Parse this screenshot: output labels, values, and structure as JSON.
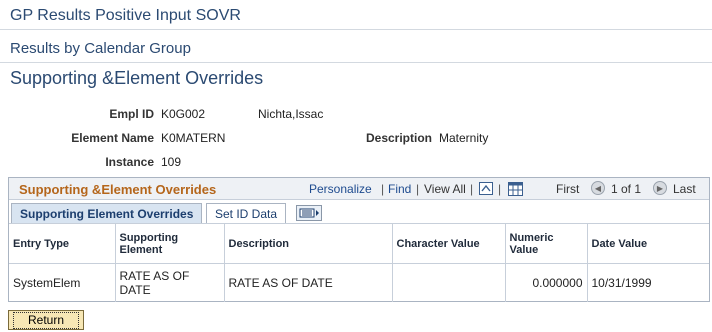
{
  "app_title": "GP Results Positive Input SOVR",
  "breadcrumb": "Results by Calendar Group",
  "page_heading": "Supporting &Element Overrides",
  "fields": {
    "empl_id_label": "Empl ID",
    "empl_id_value": "K0G002",
    "name_value": "Nichta,Issac",
    "element_name_label": "Element Name",
    "element_name_value": "K0MATERN",
    "description_label": "Description",
    "description_value": "Maternity",
    "instance_label": "Instance",
    "instance_value": "109"
  },
  "grid": {
    "title": "Supporting &Element Overrides",
    "personalize": "Personalize",
    "find": "Find",
    "sep": "|",
    "view_all": "View All",
    "first": "First",
    "range": "1 of 1",
    "last": "Last",
    "tabs": {
      "active": "Supporting Element Overrides",
      "inactive": "Set ID Data"
    },
    "columns": {
      "entry_type": "Entry Type",
      "supporting_element": "Supporting Element",
      "description": "Description",
      "character_value": "Character Value",
      "numeric_value": "Numeric Value",
      "date_value": "Date Value"
    },
    "rows": [
      {
        "entry_type": "SystemElem",
        "supporting_element": "RATE AS OF DATE",
        "description": "RATE AS OF DATE",
        "character_value": "",
        "numeric_value": "0.000000",
        "date_value": "10/31/1999"
      }
    ]
  },
  "return_label": "Return",
  "colors": {
    "heading_blue": "#2b4a72",
    "grid_title_orange": "#b5661b",
    "link_blue": "#1e4b8f",
    "button_fill": "#f7e7b5"
  },
  "icons": [
    "download-icon",
    "grid-icon",
    "previous-icon",
    "next-icon",
    "show-all-columns-icon"
  ]
}
